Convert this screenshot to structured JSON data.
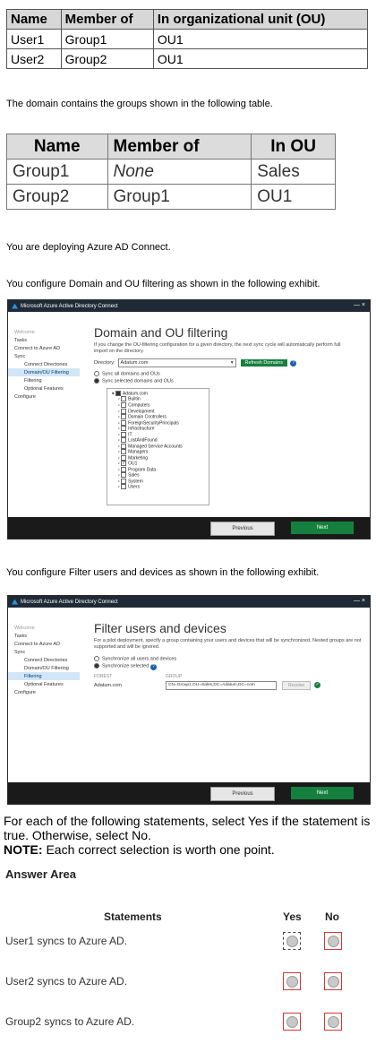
{
  "table1": {
    "headers": [
      "Name",
      "Member of",
      "In organizational unit (OU)"
    ],
    "rows": [
      [
        "User1",
        "Group1",
        "OU1"
      ],
      [
        "User2",
        "Group2",
        "OU1"
      ]
    ]
  },
  "intro_groups": "The domain contains the groups shown in the following table.",
  "table2": {
    "headers": [
      "Name",
      "Member of",
      "In OU"
    ],
    "rows": [
      [
        "Group1",
        "None",
        "Sales"
      ],
      [
        "Group2",
        "Group1",
        "OU1"
      ]
    ]
  },
  "deploy_text": "You are deploying Azure AD Connect.",
  "exhibit1_text": "You configure Domain and OU filtering as shown in the following exhibit.",
  "exhibit2_text": "You configure Filter users and devices as shown in the following exhibit.",
  "window": {
    "title": "Microsoft Azure Active Directory Connect",
    "close": "—  ×",
    "nav": {
      "welcome": "Welcome",
      "tasks": "Tasks",
      "connect": "Connect to Azure AD",
      "sync": "Sync",
      "connect_dirs": "Connect Directories",
      "domain_ou": "Domain/OU Filtering",
      "filtering": "Filtering",
      "optional": "Optional Features",
      "configure": "Configure"
    },
    "previous": "Previous",
    "next": "Next"
  },
  "ou_screen": {
    "heading": "Domain and OU filtering",
    "desc": "If you change the OU-filtering configuration for a given directory, the next sync cycle will automatically perform full import on the directory.",
    "directory_label": "Directory:",
    "directory_value": "Adatum.com",
    "refresh": "Refresh Domains",
    "opt_all": "Sync all domains and OUs",
    "opt_selected": "Sync selected domains and OUs",
    "tree_root": "Adatum.com",
    "tree_items": [
      "Builtin",
      "Computers",
      "Development",
      "Domain Controllers",
      "ForeignSecurityPrincipals",
      "Infrastructure",
      "IT",
      "LostAndFound",
      "Managed Service Accounts",
      "Managers",
      "Marketing",
      "OU1",
      "Program Data",
      "Sales",
      "System",
      "Users"
    ]
  },
  "filter_screen": {
    "heading": "Filter users and devices",
    "desc": "For a pilot deployment, specify a group containing your users and devices that will be synchronized. Nested groups are not supported and will be ignored.",
    "opt_all": "Synchronize all users and devices",
    "opt_selected": "Synchronize selected",
    "forest_label": "FOREST",
    "group_label": "GROUP",
    "forest_value": "Adatum.com",
    "group_value": "CN=Group1,OU=Sales,DC=Adatum,DC=com",
    "resolve": "Resolve"
  },
  "instructions": "For each of the following statements, select Yes if the statement is true. Otherwise, select No.",
  "note_label": "NOTE:",
  "note_text": " Each correct selection is worth one point.",
  "answer_area": "Answer Area",
  "statements_header": "Statements",
  "yes_label": "Yes",
  "no_label": "No",
  "statements": [
    "User1 syncs to Azure AD.",
    "User2 syncs to Azure AD.",
    "Group2 syncs to Azure AD."
  ],
  "colors": {
    "accent_green": "#15803d",
    "selection": "#d2e6f7",
    "option_border": "#dd3333"
  }
}
